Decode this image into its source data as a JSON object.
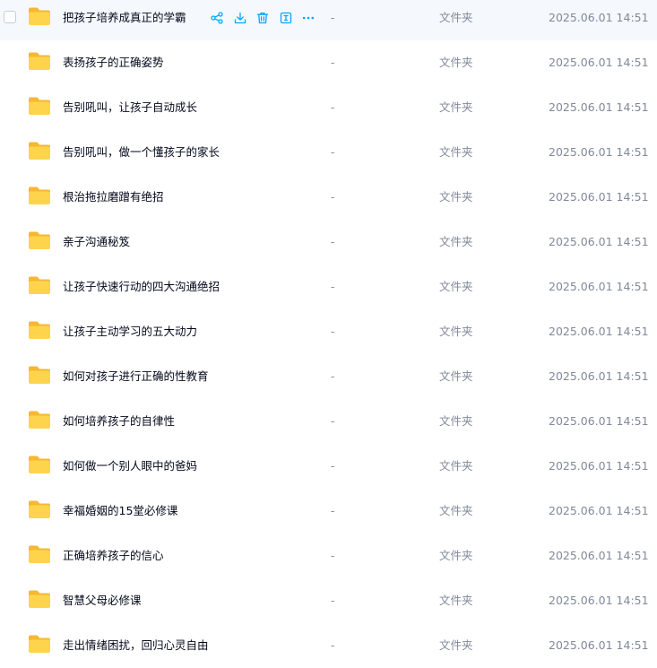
{
  "colors": {
    "folder_back": "#f5b82e",
    "folder_front": "#ffd44d",
    "action_icon": "#06a7ff",
    "row_hover": "#f5f8fd",
    "muted_text": "#818999",
    "primary_text": "#03081a"
  },
  "action_icons": [
    "share-icon",
    "download-icon",
    "delete-icon",
    "rename-icon",
    "more-icon"
  ],
  "files": [
    {
      "name": "把孩子培养成真正的学霸",
      "size": "-",
      "type": "文件夹",
      "modified": "2025.06.01 14:51",
      "hovered": true
    },
    {
      "name": "表扬孩子的正确姿势",
      "size": "-",
      "type": "文件夹",
      "modified": "2025.06.01 14:51"
    },
    {
      "name": "告别吼叫，让孩子自动成长",
      "size": "-",
      "type": "文件夹",
      "modified": "2025.06.01 14:51"
    },
    {
      "name": "告别吼叫，做一个懂孩子的家长",
      "size": "-",
      "type": "文件夹",
      "modified": "2025.06.01 14:51"
    },
    {
      "name": "根治拖拉磨蹭有绝招",
      "size": "-",
      "type": "文件夹",
      "modified": "2025.06.01 14:51"
    },
    {
      "name": "亲子沟通秘笈",
      "size": "-",
      "type": "文件夹",
      "modified": "2025.06.01 14:51"
    },
    {
      "name": "让孩子快速行动的四大沟通绝招",
      "size": "-",
      "type": "文件夹",
      "modified": "2025.06.01 14:51"
    },
    {
      "name": "让孩子主动学习的五大动力",
      "size": "-",
      "type": "文件夹",
      "modified": "2025.06.01 14:51"
    },
    {
      "name": "如何对孩子进行正确的性教育",
      "size": "-",
      "type": "文件夹",
      "modified": "2025.06.01 14:51"
    },
    {
      "name": "如何培养孩子的自律性",
      "size": "-",
      "type": "文件夹",
      "modified": "2025.06.01 14:51"
    },
    {
      "name": "如何做一个别人眼中的爸妈",
      "size": "-",
      "type": "文件夹",
      "modified": "2025.06.01 14:51"
    },
    {
      "name": "幸福婚姻的15堂必修课",
      "size": "-",
      "type": "文件夹",
      "modified": "2025.06.01 14:51"
    },
    {
      "name": "正确培养孩子的信心",
      "size": "-",
      "type": "文件夹",
      "modified": "2025.06.01 14:51"
    },
    {
      "name": "智慧父母必修课",
      "size": "-",
      "type": "文件夹",
      "modified": "2025.06.01 14:51"
    },
    {
      "name": "走出情绪困扰，回归心灵自由",
      "size": "-",
      "type": "文件夹",
      "modified": "2025.06.01 14:51"
    }
  ]
}
